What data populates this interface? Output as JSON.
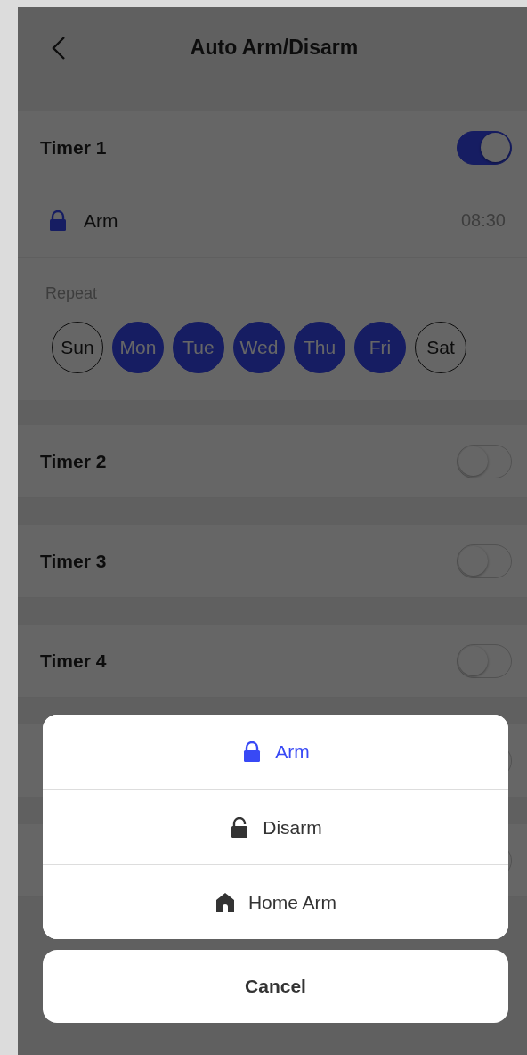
{
  "header": {
    "title": "Auto Arm/Disarm"
  },
  "timers": [
    {
      "label": "Timer 1",
      "on": true,
      "mode": {
        "kind": "lock",
        "label": "Arm",
        "time": "08:30"
      },
      "repeat_label": "Repeat",
      "days": [
        {
          "label": "Sun",
          "selected": false
        },
        {
          "label": "Mon",
          "selected": true
        },
        {
          "label": "Tue",
          "selected": true
        },
        {
          "label": "Wed",
          "selected": true
        },
        {
          "label": "Thu",
          "selected": true
        },
        {
          "label": "Fri",
          "selected": true
        },
        {
          "label": "Sat",
          "selected": false
        }
      ]
    },
    {
      "label": "Timer 2",
      "on": false
    },
    {
      "label": "Timer 3",
      "on": false
    },
    {
      "label": "Timer 4",
      "on": false
    },
    {
      "on": false
    },
    {
      "on": false
    }
  ],
  "sheet": {
    "options": [
      {
        "kind": "lock",
        "label": "Arm",
        "selected": true
      },
      {
        "kind": "unlock",
        "label": "Disarm",
        "selected": false
      },
      {
        "kind": "home",
        "label": "Home Arm",
        "selected": false
      }
    ],
    "cancel": "Cancel"
  }
}
